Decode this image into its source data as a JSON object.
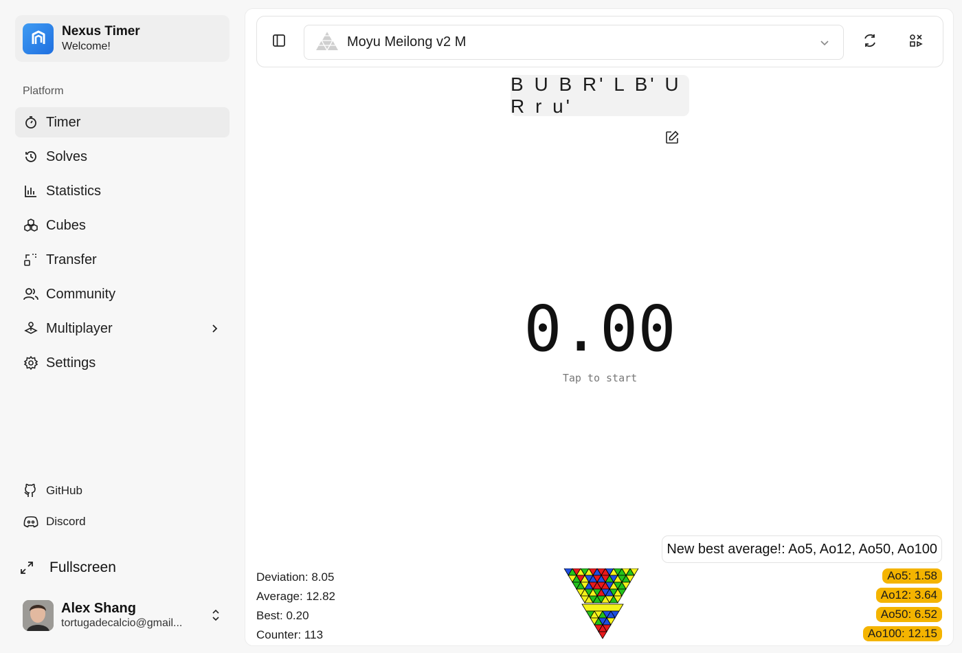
{
  "brand": {
    "title": "Nexus Timer",
    "subtitle": "Welcome!"
  },
  "sidebar": {
    "section_label": "Platform",
    "items": [
      {
        "label": "Timer",
        "icon": "timer-icon",
        "active": true
      },
      {
        "label": "Solves",
        "icon": "history-icon"
      },
      {
        "label": "Statistics",
        "icon": "bar-chart-icon"
      },
      {
        "label": "Cubes",
        "icon": "boxes-icon"
      },
      {
        "label": "Transfer",
        "icon": "transfer-icon"
      },
      {
        "label": "Community",
        "icon": "users-icon"
      },
      {
        "label": "Multiplayer",
        "icon": "joystick-icon",
        "has_submenu": true
      },
      {
        "label": "Settings",
        "icon": "gear-icon"
      }
    ],
    "external": [
      {
        "label": "GitHub",
        "icon": "github-icon"
      },
      {
        "label": "Discord",
        "icon": "discord-icon"
      }
    ],
    "fullscreen_label": "Fullscreen"
  },
  "user": {
    "name": "Alex Shang",
    "email": "tortugadecalcio@gmail..."
  },
  "toolbar": {
    "cube_name": "Moyu Meilong v2 M"
  },
  "scramble": "B U B R' L B' U R r u'",
  "timer": {
    "value": "0.00",
    "hint": "Tap to start"
  },
  "stats": {
    "deviation": "Deviation: 8.05",
    "average": "Average: 12.82",
    "best": "Best: 0.20",
    "counter": "Counter: 113"
  },
  "toast": "New best average!: Ao5, Ao12, Ao50, Ao100",
  "averages": [
    "Ao5: 1.58",
    "Ao12: 3.64",
    "Ao50: 6.52",
    "Ao100: 12.15"
  ],
  "colors": {
    "brand": "#2b86ea",
    "badge": "#f4b400",
    "pyra_red": "#e8191c",
    "pyra_green": "#22c21b",
    "pyra_blue": "#1f4fe0",
    "pyra_yellow": "#f3f21a"
  }
}
